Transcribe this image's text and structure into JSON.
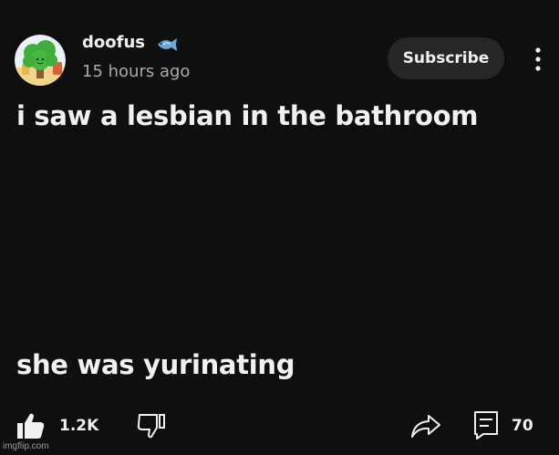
{
  "author": {
    "name": "doofus",
    "badge_icon": "fish-icon",
    "avatar_icon": "cartoon-tree-avatar"
  },
  "timestamp": "15 hours ago",
  "subscribe_label": "Subscribe",
  "post": {
    "line1": "i saw a lesbian in the bathroom",
    "line2": "she was yurinating"
  },
  "actions": {
    "like_count": "1.2K",
    "comment_count": "70"
  },
  "watermark": "imgflip.com",
  "colors": {
    "background": "#0f0f0f",
    "text": "#f1f1f1",
    "secondary_text": "#aaaaaa",
    "button_bg": "#272727"
  }
}
